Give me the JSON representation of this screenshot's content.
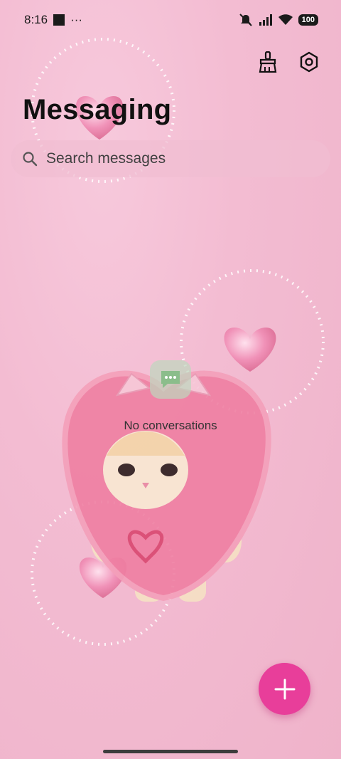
{
  "status_bar": {
    "time": "8:16",
    "notification_more": "···",
    "battery": "100"
  },
  "header": {
    "title": "Messaging"
  },
  "search": {
    "placeholder": "Search messages"
  },
  "empty_state": {
    "text": "No conversations"
  },
  "colors": {
    "accent": "#e83e9a",
    "background": "#f3bcd2"
  },
  "icons": {
    "clean": "broom-icon",
    "settings": "settings-hexagon-icon",
    "search": "search-icon",
    "compose": "plus-icon",
    "empty": "chat-bubble-icon"
  }
}
